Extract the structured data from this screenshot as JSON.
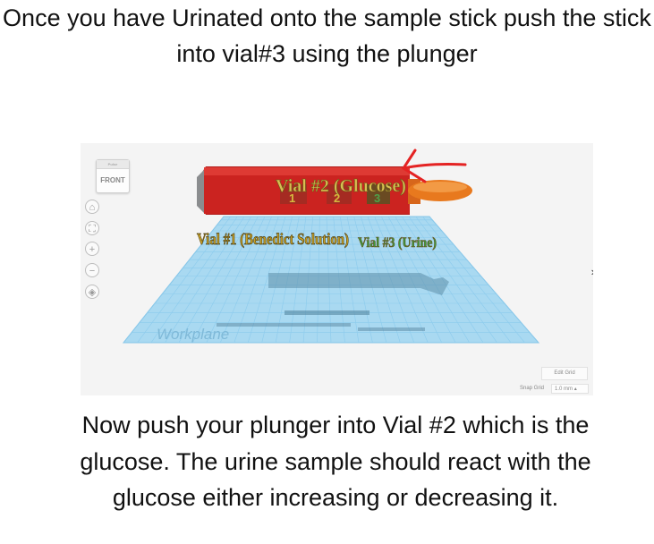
{
  "top_text": "Once you have Urinated onto the sample stick push the stick into vial#3 using the plunger",
  "bottom_text": "Now push your plunger into Vial #2 which is the glucose. The urine sample should react with the glucose either increasing or decreasing it.",
  "viewport": {
    "viewcube": {
      "face_label": "FRONT",
      "top_label": "Pulse"
    },
    "tools": [
      "home-icon",
      "fit-icon",
      "zoom-in-icon",
      "zoom-out-icon",
      "perspective-icon"
    ],
    "workplane_label": "Workplane",
    "vial2_label": "Vial #2 (Glucose)",
    "vial1_label": "Vial #1 (Benedict Solution)",
    "vial3_label": "Vial #3 (Urine)",
    "vial_numbers": [
      "1",
      "2",
      "3"
    ],
    "edit_grid_label": "Edit Grid",
    "snap_grid_label": "Snap Grid",
    "snap_grid_value": "1.0 mm",
    "colors": {
      "vial_red": "#c8201d",
      "plunger_orange": "#e8791e",
      "grid_blue": "#9fd3ee",
      "annotation_red": "#e42323",
      "label_gold": "#c9a227",
      "label_green": "#3c9a3c"
    }
  }
}
